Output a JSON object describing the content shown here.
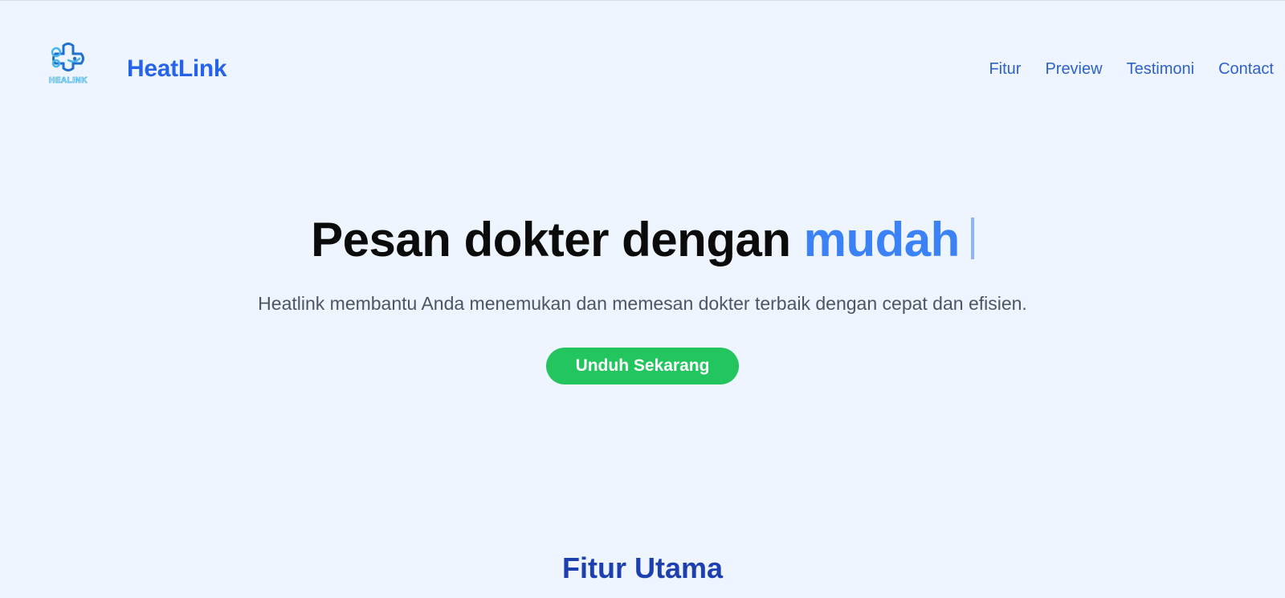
{
  "header": {
    "logo_text": "HEALINK",
    "brand": "HeatLink",
    "nav": [
      {
        "label": "Fitur"
      },
      {
        "label": "Preview"
      },
      {
        "label": "Testimoni"
      },
      {
        "label": "Contact"
      }
    ]
  },
  "hero": {
    "title_main": "Pesan dokter dengan",
    "title_accent": "mudah",
    "subtitle": "Heatlink membantu Anda menemukan dan memesan dokter terbaik dengan cepat dan efisien.",
    "cta_label": "Unduh Sekarang"
  },
  "features": {
    "title": "Fitur Utama"
  },
  "colors": {
    "background": "#eef5fe",
    "brand": "#2563eb",
    "accent": "#3b82f6",
    "cta": "#22c55e",
    "section_title": "#1e40af"
  },
  "icons": {
    "logo": "healink-cross-logo"
  }
}
